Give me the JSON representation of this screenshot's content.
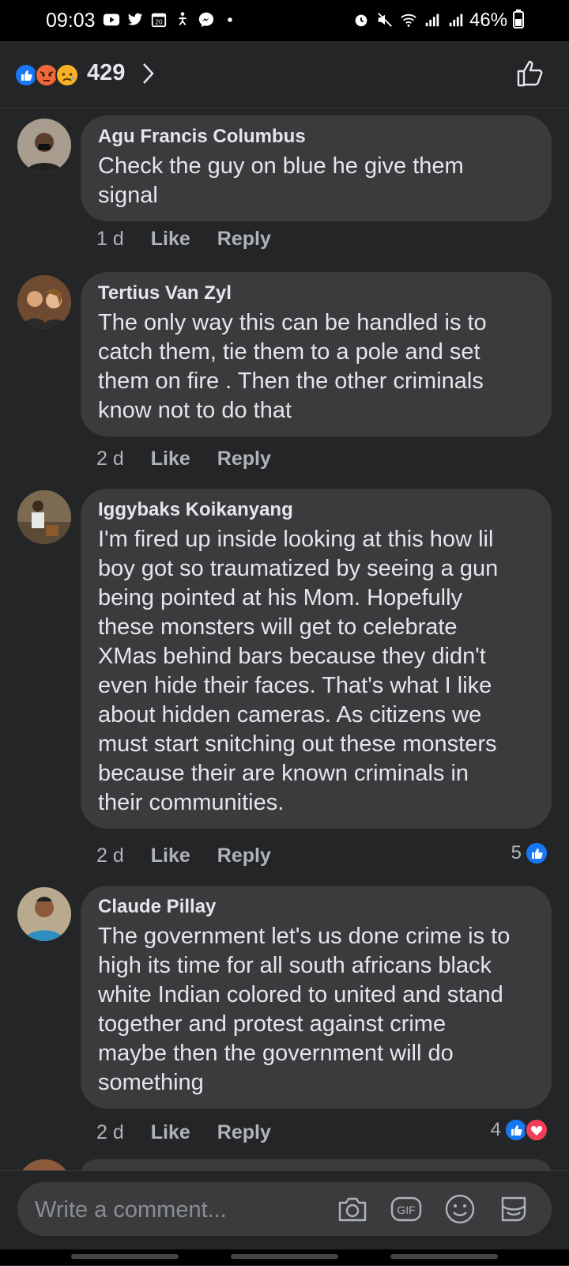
{
  "status_bar": {
    "time": "09:03",
    "battery": "46%",
    "left_icons": [
      "youtube-icon",
      "twitter-icon",
      "calendar-icon",
      "accessibility-icon",
      "messenger-icon",
      "dot-icon"
    ],
    "right_icons": [
      "alarm-icon",
      "mute-icon",
      "wifi-icon",
      "signal-icon",
      "signal-icon",
      "battery-icon"
    ]
  },
  "reactions": {
    "count": "429",
    "types": [
      "like",
      "angry",
      "sad"
    ]
  },
  "comments": [
    {
      "author": "Agu Francis Columbus",
      "text": "Check the guy on blue he give them\nsignal",
      "time": "1 d",
      "like_label": "Like",
      "reply_label": "Reply",
      "reaction_count": ""
    },
    {
      "author": "Tertius Van Zyl",
      "text": "The only way this can be handled is to\ncatch them, tie them to a pole and set\nthem on fire . Then the other criminals\nknow not to do that",
      "time": "2 d",
      "like_label": "Like",
      "reply_label": "Reply",
      "reaction_count": ""
    },
    {
      "author": "Iggybaks Koikanyang",
      "text": "I'm fired up inside looking at this how lil\nboy got so traumatized by seeing a gun\nbeing pointed at his Mom. Hopefully\nthese monsters will get to celebrate\nXMas behind bars because they didn't\neven hide their faces. That's what I like\nabout hidden cameras. As citizens we\nmust start snitching out these monsters\nbecause their are known criminals in\ntheir communities.",
      "time": "2 d",
      "like_label": "Like",
      "reply_label": "Reply",
      "reaction_count": "5"
    },
    {
      "author": "Claude Pillay",
      "text": "The government let's us done crime is to\nhigh its time for all south africans black\nwhite Indian colored to united and stand\ntogether and protest against crime\nmaybe then the government will do\nsomething",
      "time": "2 d",
      "like_label": "Like",
      "reply_label": "Reply",
      "reaction_count": "4"
    }
  ],
  "composer": {
    "placeholder": "Write a comment...",
    "icons": [
      "camera-icon",
      "gif-icon",
      "emoji-icon",
      "sticker-icon"
    ]
  },
  "colors": {
    "background": "#242526",
    "bubble": "#3a3b3c",
    "like_blue": "#1877f2",
    "love_red": "#f33e58"
  }
}
